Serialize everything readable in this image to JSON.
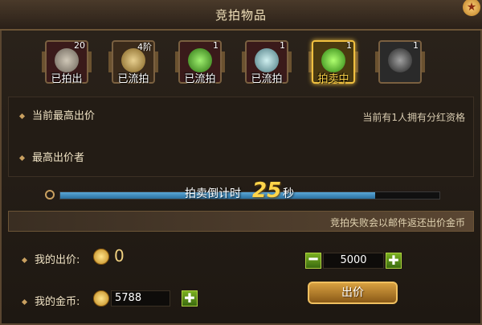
{
  "title": "竞拍物品",
  "items": [
    {
      "count": "20",
      "status": "已拍出",
      "icon": "statue-icon",
      "color": "#a8a090"
    },
    {
      "count": "4阶",
      "status": "已流拍",
      "icon": "weapon-icon",
      "color": "#c0a060"
    },
    {
      "count": "1",
      "status": "已流拍",
      "icon": "potion-icon",
      "color": "#60c040"
    },
    {
      "count": "1",
      "status": "已流拍",
      "icon": "ring-icon",
      "color": "#90c0c8"
    },
    {
      "count": "1",
      "status": "拍卖中",
      "icon": "potion-icon",
      "color": "#58d040"
    },
    {
      "count": "1",
      "status": "",
      "icon": "bag-icon",
      "color": "#707070"
    }
  ],
  "info": {
    "highest_bid_label": "当前最高出价",
    "bidder_label": "最高出价者",
    "dividend_text": "当前有1人拥有分红资格"
  },
  "timer": {
    "label": "拍卖倒计时",
    "value": "25",
    "unit": "秒",
    "progress": 0.83
  },
  "notice": "竞拍失败会以邮件返还出价金币",
  "my_bid": {
    "label": "我的出价:",
    "value": "0"
  },
  "my_gold": {
    "label": "我的金币:",
    "value": "5788"
  },
  "bid_amount": "5000",
  "bid_button": "出价"
}
